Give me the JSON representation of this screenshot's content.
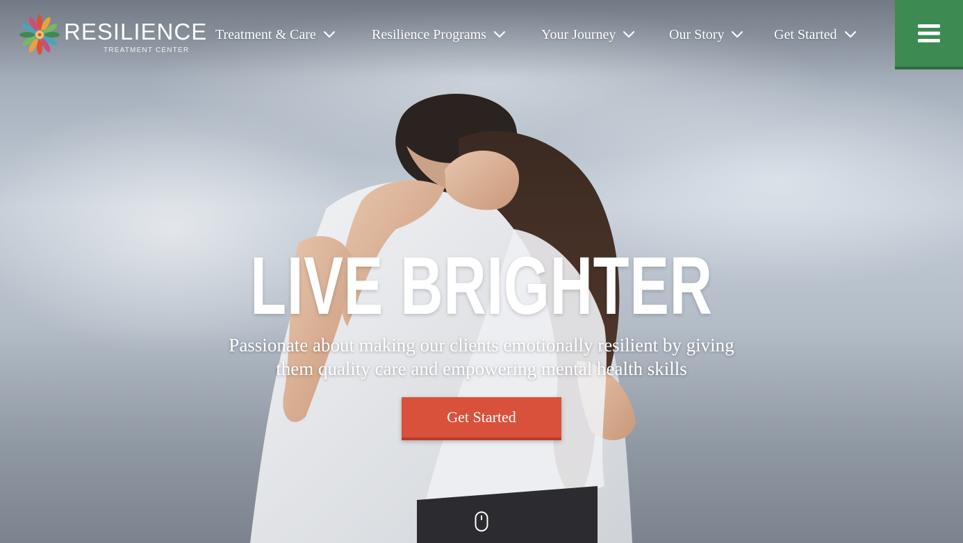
{
  "brand": {
    "name": "RESILIENCE",
    "subtitle": "TREATMENT CENTER",
    "logo_icon": "flower-burst-icon",
    "logo_colors": [
      "#d9513a",
      "#e9a23b",
      "#7bb661",
      "#3d8a52",
      "#c94f7c",
      "#4fa3b8"
    ]
  },
  "nav": {
    "items": [
      {
        "label": "Treatment & Care",
        "icon": "chevron-down-icon"
      },
      {
        "label": "Resilience Programs",
        "icon": "chevron-down-icon"
      },
      {
        "label": "Your Journey",
        "icon": "chevron-down-icon"
      },
      {
        "label": "Our Story",
        "icon": "chevron-down-icon"
      },
      {
        "label": "Get Started",
        "icon": "chevron-down-icon"
      }
    ],
    "menu_icon": "hamburger-menu-icon",
    "menu_color": "#3d8a52"
  },
  "hero": {
    "headline": "LIVE BRIGHTER",
    "subtitle_line1": "Passionate about making our clients emotionally resilient by giving",
    "subtitle_line2": "them quality care and empowering mental health skills",
    "cta_label": "Get Started",
    "cta_color": "#d9513a",
    "scroll_icon": "mouse-scroll-icon"
  }
}
